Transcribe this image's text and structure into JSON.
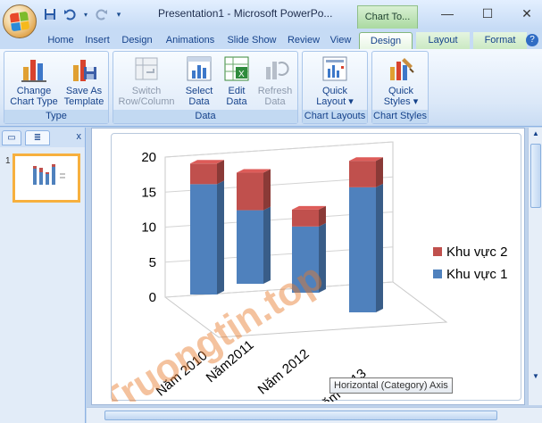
{
  "window": {
    "title": "Presentation1 - Microsoft PowerPo...",
    "context_tab_header": "Chart To...",
    "minimize": "—",
    "maximize": "☐",
    "close": "✕"
  },
  "qat": {
    "save": "💾",
    "undo": "↶",
    "redo": "↻",
    "customize": "▾"
  },
  "tabs": {
    "home": "Home",
    "insert": "Insert",
    "design": "Design",
    "animations": "Animations",
    "slideshow": "Slide Show",
    "review": "Review",
    "view": "View",
    "chart_design": "Design",
    "layout": "Layout",
    "format": "Format",
    "help": "?"
  },
  "ribbon": {
    "groups": {
      "type": "Type",
      "data": "Data",
      "chart_layouts": "Chart Layouts",
      "chart_styles": "Chart Styles"
    },
    "buttons": {
      "change_chart_type": [
        "Change",
        "Chart Type"
      ],
      "save_as_template": [
        "Save As",
        "Template"
      ],
      "switch_row_column": [
        "Switch",
        "Row/Column"
      ],
      "select_data": [
        "Select",
        "Data"
      ],
      "edit_data": [
        "Edit",
        "Data"
      ],
      "refresh_data": [
        "Refresh",
        "Data"
      ],
      "quick_layout": [
        "Quick",
        "Layout ▾"
      ],
      "quick_styles": [
        "Quick",
        "Styles ▾"
      ]
    }
  },
  "left_panel": {
    "slide_number": "1",
    "close": "x"
  },
  "chart_data": {
    "type": "bar",
    "stacked": true,
    "categories": [
      "Năm 2010",
      "Năm2011",
      "Năm 2012",
      "Năm 2013"
    ],
    "series": [
      {
        "name": "Khu vực 1",
        "values": [
          15,
          10,
          9,
          17
        ],
        "color": "#4f81bd"
      },
      {
        "name": "Khu vực 2",
        "values": [
          2.8,
          5.1,
          2.3,
          3.6
        ],
        "color": "#c0504d"
      }
    ],
    "ylim": [
      0,
      20
    ],
    "yticks": [
      "0",
      "5",
      "10",
      "15",
      "20"
    ],
    "legend_position": "right",
    "gridlines": true
  },
  "tooltip": "Horizontal (Category) Axis",
  "watermark": "Truongtin.top"
}
